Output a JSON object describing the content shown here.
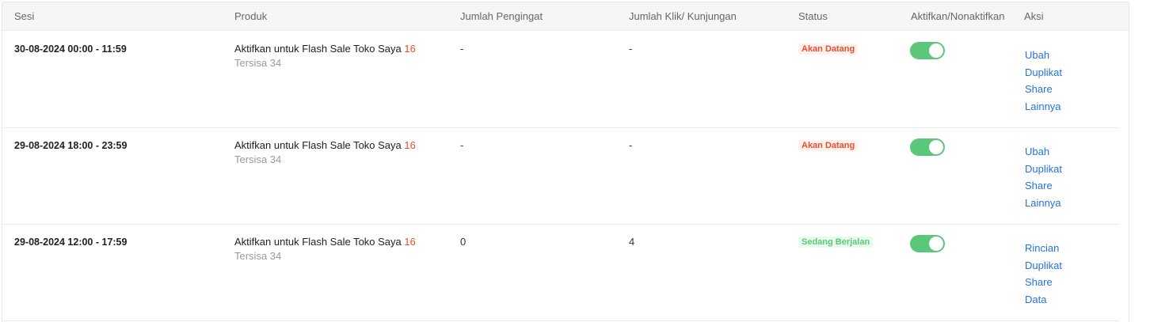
{
  "table": {
    "headers": {
      "session": "Sesi",
      "product": "Produk",
      "reminders": "Jumlah Pengingat",
      "clicks": "Jumlah Klik/ Kunjungan",
      "status": "Status",
      "toggle": "Aktifkan/Nonaktifkan",
      "actions": "Aksi"
    },
    "rows": [
      {
        "session": "30-08-2024 00:00 - 11:59",
        "product_label": "Aktifkan untuk Flash Sale Toko Saya",
        "product_count": "16",
        "remaining": "Tersisa 34",
        "reminders": "-",
        "clicks": "-",
        "status": "Akan Datang",
        "enabled": true,
        "actions": [
          "Ubah",
          "Duplikat",
          "Share",
          "Lainnya"
        ]
      },
      {
        "session": "29-08-2024 18:00 - 23:59",
        "product_label": "Aktifkan untuk Flash Sale Toko Saya",
        "product_count": "16",
        "remaining": "Tersisa 34",
        "reminders": "-",
        "clicks": "-",
        "status": "Akan Datang",
        "enabled": true,
        "actions": [
          "Ubah",
          "Duplikat",
          "Share",
          "Lainnya"
        ]
      },
      {
        "session": "29-08-2024 12:00 - 17:59",
        "product_label": "Aktifkan untuk Flash Sale Toko Saya",
        "product_count": "16",
        "remaining": "Tersisa 34",
        "reminders": "0",
        "clicks": "4",
        "status": "Sedang Berjalan",
        "enabled": true,
        "actions": [
          "Rincian",
          "Duplikat",
          "Share",
          "Data"
        ]
      }
    ]
  },
  "colors": {
    "accent_orange": "#ee4d2d",
    "toggle_on": "#5ac878",
    "link_blue": "#2673dd",
    "status_ongoing": "#55cc77"
  }
}
